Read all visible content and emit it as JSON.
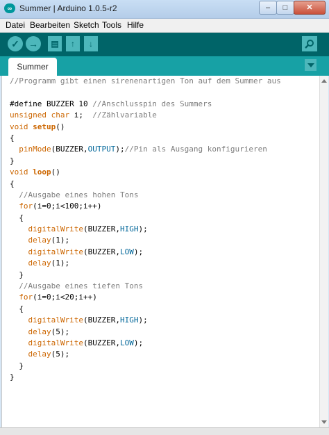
{
  "window": {
    "title": "Summer | Arduino 1.0.5-r2",
    "logo_text": "∞",
    "minimize_glyph": "–",
    "maximize_glyph": "□",
    "close_glyph": "✕"
  },
  "menu": [
    "Datei",
    "Bearbeiten",
    "Sketch",
    "Tools",
    "Hilfe"
  ],
  "toolbar": {
    "verify_icon": "check-icon",
    "upload_icon": "arrow-right-icon",
    "new_icon": "new-file-icon",
    "open_icon": "open-arrow-up-icon",
    "save_icon": "save-arrow-down-icon",
    "serial_monitor_icon": "magnifier-icon"
  },
  "tabs": [
    {
      "label": "Summer",
      "active": true
    }
  ],
  "colors": {
    "toolbar_bg": "#006468",
    "tab_bar_bg": "#17a1a5",
    "button_bg": "#4db7bb",
    "keyword": "#cc6600",
    "constant": "#006699",
    "comment": "#7e7e7e"
  },
  "code_lines": [
    [
      {
        "t": "//Programm gibt einen sirenenartigen Ton auf dem Summer aus",
        "c": "comment"
      }
    ],
    [],
    [
      {
        "t": "#define BUZZER 10 ",
        "c": "plain"
      },
      {
        "t": "//Anschlusspin des Summers",
        "c": "comment"
      }
    ],
    [
      {
        "t": "unsigned char",
        "c": "keyword"
      },
      {
        "t": " i;  ",
        "c": "plain"
      },
      {
        "t": "//Zählvariable",
        "c": "comment"
      }
    ],
    [
      {
        "t": "void",
        "c": "keyword"
      },
      {
        "t": " ",
        "c": "plain"
      },
      {
        "t": "setup",
        "c": "keyword-bold"
      },
      {
        "t": "()",
        "c": "plain"
      }
    ],
    [
      {
        "t": "{",
        "c": "plain"
      }
    ],
    [
      {
        "t": "  ",
        "c": "plain"
      },
      {
        "t": "pinMode",
        "c": "keyword"
      },
      {
        "t": "(BUZZER,",
        "c": "plain"
      },
      {
        "t": "OUTPUT",
        "c": "constant"
      },
      {
        "t": ");",
        "c": "plain"
      },
      {
        "t": "//Pin als Ausgang konfigurieren",
        "c": "comment"
      }
    ],
    [
      {
        "t": "}",
        "c": "plain"
      }
    ],
    [
      {
        "t": "void",
        "c": "keyword"
      },
      {
        "t": " ",
        "c": "plain"
      },
      {
        "t": "loop",
        "c": "keyword-bold"
      },
      {
        "t": "()",
        "c": "plain"
      }
    ],
    [
      {
        "t": "{",
        "c": "plain"
      }
    ],
    [
      {
        "t": "  ",
        "c": "plain"
      },
      {
        "t": "//Ausgabe eines hohen Tons",
        "c": "comment"
      }
    ],
    [
      {
        "t": "  ",
        "c": "plain"
      },
      {
        "t": "for",
        "c": "keyword"
      },
      {
        "t": "(i=0;i<100;i++)",
        "c": "plain"
      }
    ],
    [
      {
        "t": "  {",
        "c": "plain"
      }
    ],
    [
      {
        "t": "    ",
        "c": "plain"
      },
      {
        "t": "digitalWrite",
        "c": "keyword"
      },
      {
        "t": "(BUZZER,",
        "c": "plain"
      },
      {
        "t": "HIGH",
        "c": "constant"
      },
      {
        "t": ");",
        "c": "plain"
      }
    ],
    [
      {
        "t": "    ",
        "c": "plain"
      },
      {
        "t": "delay",
        "c": "keyword"
      },
      {
        "t": "(1);",
        "c": "plain"
      }
    ],
    [
      {
        "t": "    ",
        "c": "plain"
      },
      {
        "t": "digitalWrite",
        "c": "keyword"
      },
      {
        "t": "(BUZZER,",
        "c": "plain"
      },
      {
        "t": "LOW",
        "c": "constant"
      },
      {
        "t": ");",
        "c": "plain"
      }
    ],
    [
      {
        "t": "    ",
        "c": "plain"
      },
      {
        "t": "delay",
        "c": "keyword"
      },
      {
        "t": "(1);",
        "c": "plain"
      }
    ],
    [
      {
        "t": "  }",
        "c": "plain"
      }
    ],
    [
      {
        "t": "  ",
        "c": "plain"
      },
      {
        "t": "//Ausgabe eines tiefen Tons",
        "c": "comment"
      }
    ],
    [
      {
        "t": "  ",
        "c": "plain"
      },
      {
        "t": "for",
        "c": "keyword"
      },
      {
        "t": "(i=0;i<20;i++)",
        "c": "plain"
      }
    ],
    [
      {
        "t": "  {",
        "c": "plain"
      }
    ],
    [
      {
        "t": "    ",
        "c": "plain"
      },
      {
        "t": "digitalWrite",
        "c": "keyword"
      },
      {
        "t": "(BUZZER,",
        "c": "plain"
      },
      {
        "t": "HIGH",
        "c": "constant"
      },
      {
        "t": ");",
        "c": "plain"
      }
    ],
    [
      {
        "t": "    ",
        "c": "plain"
      },
      {
        "t": "delay",
        "c": "keyword"
      },
      {
        "t": "(5);",
        "c": "plain"
      }
    ],
    [
      {
        "t": "    ",
        "c": "plain"
      },
      {
        "t": "digitalWrite",
        "c": "keyword"
      },
      {
        "t": "(BUZZER,",
        "c": "plain"
      },
      {
        "t": "LOW",
        "c": "constant"
      },
      {
        "t": ");",
        "c": "plain"
      }
    ],
    [
      {
        "t": "    ",
        "c": "plain"
      },
      {
        "t": "delay",
        "c": "keyword"
      },
      {
        "t": "(5);",
        "c": "plain"
      }
    ],
    [
      {
        "t": "  }",
        "c": "plain"
      }
    ],
    [
      {
        "t": "}",
        "c": "plain"
      }
    ]
  ]
}
